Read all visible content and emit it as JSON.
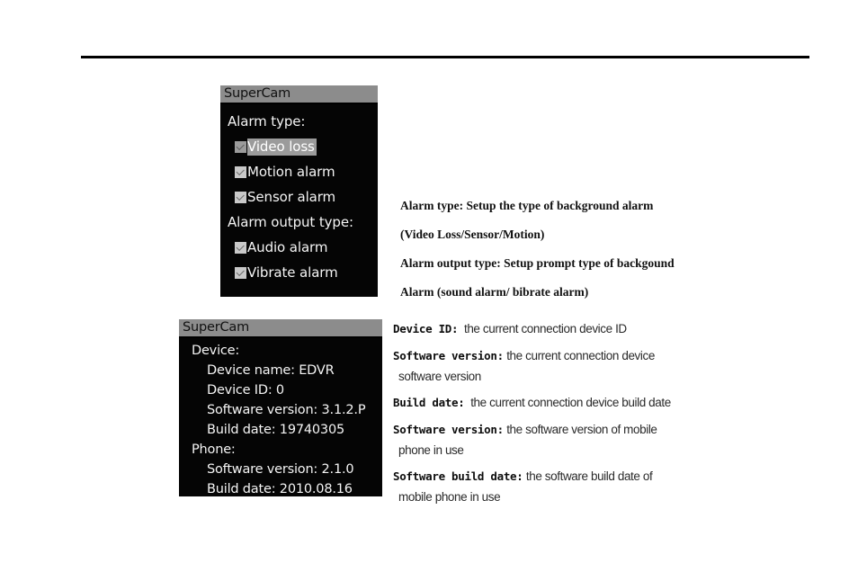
{
  "page": {
    "background_color": "#ffffff",
    "rule_color": "#000000"
  },
  "alarm_panel": {
    "title": "SuperCam",
    "title_bar_color": "#8c8c8c",
    "screen_color": "#050505",
    "group_alarm_type_label": "Alarm type:",
    "group_alarm_output_label": "Alarm output type:",
    "items": [
      {
        "label": "Video loss",
        "checked": true,
        "selected": true
      },
      {
        "label": "Motion alarm",
        "checked": true,
        "selected": false
      },
      {
        "label": "Sensor alarm",
        "checked": true,
        "selected": false
      }
    ],
    "output_items": [
      {
        "label": "Audio alarm",
        "checked": true,
        "selected": false
      },
      {
        "label": "Vibrate alarm",
        "checked": true,
        "selected": false
      }
    ]
  },
  "device_panel": {
    "title": "SuperCam",
    "title_bar_color": "#8c8c8c",
    "screen_color": "#050505",
    "sections": [
      {
        "heading": "Device:",
        "lines": [
          "Device name: EDVR",
          "Device ID: 0",
          "Software version: 3.1.2.P",
          "Build date: 19740305"
        ]
      },
      {
        "heading": "Phone:",
        "lines": [
          "Software version: 2.1.0",
          "Build date: 2010.08.16"
        ]
      }
    ]
  },
  "alarm_annotation": {
    "lines": [
      "Alarm type:  Setup the type of background alarm",
      "(Video Loss/Sensor/Motion)",
      "Alarm output type: Setup prompt type of backgound",
      "Alarm (sound alarm/ bibrate alarm)"
    ]
  },
  "device_annotation": {
    "items": [
      {
        "label": "Device ID:",
        "desc": "the current connection device ID",
        "desc2": ""
      },
      {
        "label": "Software version:",
        "desc": "the current connection device",
        "desc2": "software version"
      },
      {
        "label": "Build date:",
        "desc": "the current connection device build date",
        "desc2": ""
      },
      {
        "label": "Software version:",
        "desc": "the  software version of mobile",
        "desc2": "phone in use"
      },
      {
        "label": "Software build date:",
        "desc": "the software build date of",
        "desc2": "mobile  phone in use"
      }
    ]
  }
}
